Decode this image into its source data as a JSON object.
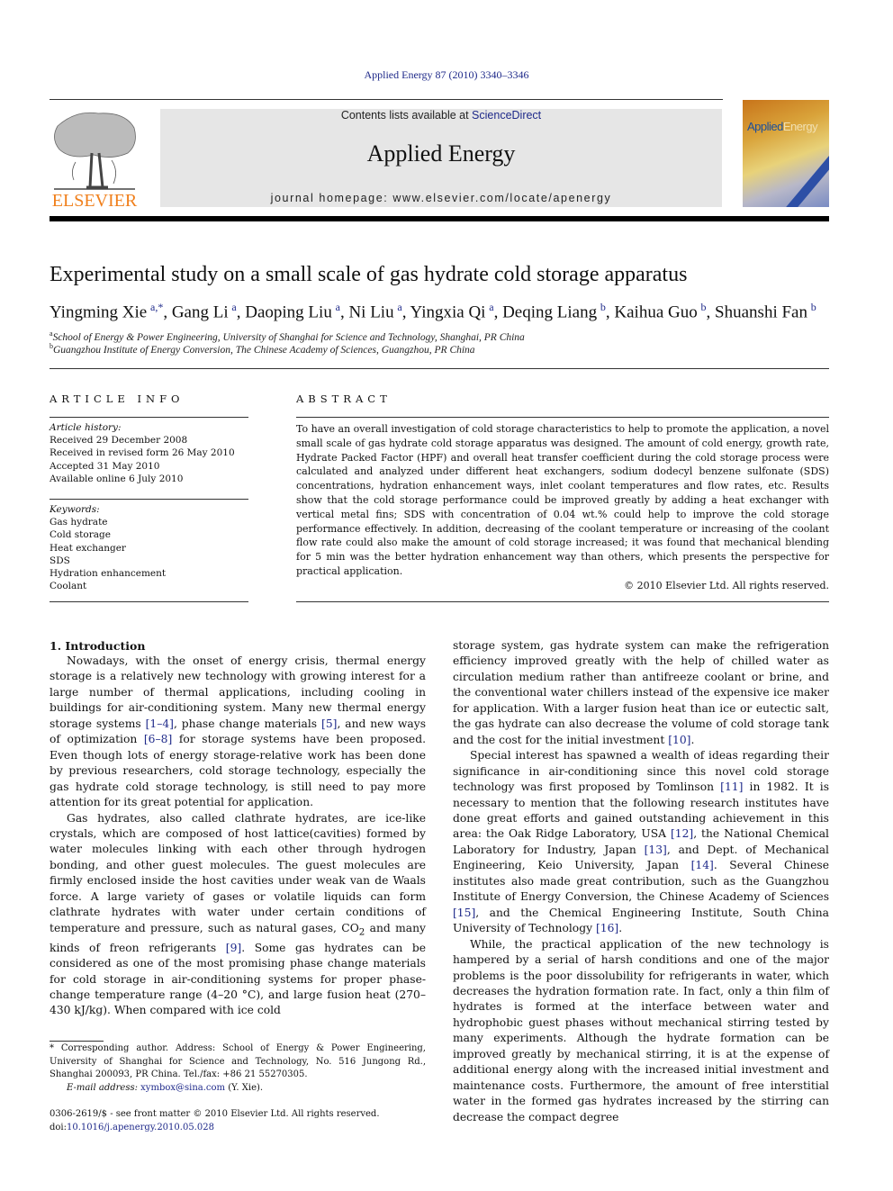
{
  "header": {
    "citation": "Applied Energy 87 (2010) 3340–3346",
    "contents_prefix": "Contents lists available at ",
    "contents_link": "ScienceDirect",
    "journal_name": "Applied Energy",
    "homepage": "journal homepage: www.elsevier.com/locate/apenergy",
    "publisher_wordmark": "ELSEVIER",
    "cover_title_part1": "Applied",
    "cover_title_part2": "Energy",
    "colors": {
      "link": "#1f2a8a",
      "elsevier_orange": "#f07f1b",
      "masthead_bg": "#e6e6e6"
    }
  },
  "article": {
    "title": "Experimental study on a small scale of gas hydrate cold storage apparatus",
    "authors": [
      {
        "name": "Yingming Xie",
        "sup": "a,*"
      },
      {
        "name": "Gang Li",
        "sup": "a"
      },
      {
        "name": "Daoping Liu",
        "sup": "a"
      },
      {
        "name": "Ni Liu",
        "sup": "a"
      },
      {
        "name": "Yingxia Qi",
        "sup": "a"
      },
      {
        "name": "Deqing Liang",
        "sup": "b"
      },
      {
        "name": "Kaihua Guo",
        "sup": "b"
      },
      {
        "name": "Shuanshi Fan",
        "sup": "b"
      }
    ],
    "affiliations": [
      {
        "mark": "a",
        "text": "School of Energy & Power Engineering, University of Shanghai for Science and Technology, Shanghai, PR China"
      },
      {
        "mark": "b",
        "text": "Guangzhou Institute of Energy Conversion, The Chinese Academy of Sciences, Guangzhou, PR China"
      }
    ]
  },
  "article_info": {
    "label": "ARTICLE INFO",
    "history_label": "Article history:",
    "history": [
      "Received 29 December 2008",
      "Received in revised form 26 May 2010",
      "Accepted 31 May 2010",
      "Available online 6 July 2010"
    ],
    "keywords_label": "Keywords:",
    "keywords": [
      "Gas hydrate",
      "Cold storage",
      "Heat exchanger",
      "SDS",
      "Hydration enhancement",
      "Coolant"
    ]
  },
  "abstract": {
    "label": "ABSTRACT",
    "text": "To have an overall investigation of cold storage characteristics to help to promote the application, a novel small scale of gas hydrate cold storage apparatus was designed. The amount of cold energy, growth rate, Hydrate Packed Factor (HPF) and overall heat transfer coefficient during the cold storage process were calculated and analyzed under different heat exchangers, sodium dodecyl benzene sulfonate (SDS) concentrations, hydration enhancement ways, inlet coolant temperatures and flow rates, etc. Results show that the cold storage performance could be improved greatly by adding a heat exchanger with vertical metal fins; SDS with concentration of 0.04 wt.% could help to improve the cold storage performance effectively. In addition, decreasing of the coolant temperature or increasing of the coolant flow rate could also make the amount of cold storage increased; it was found that mechanical blending for 5 min was the better hydration enhancement way than others, which presents the perspective for practical application.",
    "copyright": "© 2010 Elsevier Ltd. All rights reserved."
  },
  "body": {
    "intro_heading": "1. Introduction",
    "p1": [
      {
        "t": "Nowadays, with the onset of energy crisis, thermal energy storage is a relatively new technology with growing interest for a large number of thermal applications, including cooling in buildings for air-conditioning system. Many new thermal energy storage systems "
      },
      {
        "c": "[1–4]"
      },
      {
        "t": ", phase change materials "
      },
      {
        "c": "[5]"
      },
      {
        "t": ", and new ways of optimization "
      },
      {
        "c": "[6–8]"
      },
      {
        "t": " for storage systems have been proposed. Even though lots of energy storage-relative work has been done by previous researchers, cold storage technology, especially the gas hydrate cold storage technology, is still need to pay more attention for its great potential for application."
      }
    ],
    "p2": [
      {
        "t": "Gas hydrates, also called clathrate hydrates, are ice-like crystals, which are composed of host lattice(cavities) formed by water molecules linking with each other through hydrogen bonding, and other guest molecules. The guest molecules are firmly enclosed inside the host cavities under weak van de Waals force. A large variety of gases or volatile liquids can form clathrate hydrates with water under certain conditions of temperature and pressure, such as natural gases, CO"
      },
      {
        "sub": "2"
      },
      {
        "t": " and many kinds of freon refrigerants "
      },
      {
        "c": "[9]"
      },
      {
        "t": ". Some gas hydrates can be considered as one of the most promising phase change materials for cold storage in air-conditioning systems for proper phase-change temperature range (4–20 °C), and large fusion heat (270–430 kJ/kg). When compared with ice cold"
      }
    ],
    "p3": [
      {
        "t": "storage system, gas hydrate system can make the refrigeration efficiency improved greatly with the help of chilled water as circulation medium rather than antifreeze coolant or brine, and the conventional water chillers instead of the expensive ice maker for application. With a larger fusion heat than ice or eutectic salt, the gas hydrate can also decrease the volume of cold storage tank and the cost for the initial investment "
      },
      {
        "c": "[10]"
      },
      {
        "t": "."
      }
    ],
    "p4": [
      {
        "t": "Special interest has spawned a wealth of ideas regarding their significance in air-conditioning since this novel cold storage technology was first proposed by Tomlinson "
      },
      {
        "c": "[11]"
      },
      {
        "t": " in 1982. It is necessary to mention that the following research institutes have done great efforts and gained outstanding achievement in this area: the Oak Ridge Laboratory, USA "
      },
      {
        "c": "[12]"
      },
      {
        "t": ", the National Chemical Laboratory for Industry, Japan "
      },
      {
        "c": "[13]"
      },
      {
        "t": ", and Dept. of Mechanical Engineering, Keio University, Japan "
      },
      {
        "c": "[14]"
      },
      {
        "t": ". Several Chinese institutes also made great contribution, such as the Guangzhou Institute of Energy Conversion, the Chinese Academy of Sciences "
      },
      {
        "c": "[15]"
      },
      {
        "t": ", and the Chemical Engineering Institute, South China University of Technology "
      },
      {
        "c": "[16]"
      },
      {
        "t": "."
      }
    ],
    "p5": [
      {
        "t": "While, the practical application of the new technology is hampered by a serial of harsh conditions and one of the major problems is the poor dissolubility for refrigerants in water, which decreases the hydration formation rate. In fact, only a thin film of hydrates is formed at the interface between water and hydrophobic guest phases without mechanical stirring tested by many experiments. Although the hydrate formation can be improved greatly by mechanical stirring, it is at the expense of additional energy along with the increased initial investment and maintenance costs. Furthermore, the amount of free interstitial water in the formed gas hydrates increased by the stirring can decrease the compact degree"
      }
    ]
  },
  "footnote": {
    "corresponding": "* Corresponding author. Address: School of Energy & Power Engineering, University of Shanghai for Science and Technology, No. 516 Jungong Rd., Shanghai 200093, PR China. Tel./fax: +86 21 55270305.",
    "email_label": "E-mail address: ",
    "email": "xymbox@sina.com",
    "email_suffix": " (Y. Xie).",
    "front_matter": "0306-2619/$ - see front matter © 2010 Elsevier Ltd. All rights reserved.",
    "doi_label": "doi:",
    "doi": "10.1016/j.apenergy.2010.05.028"
  }
}
